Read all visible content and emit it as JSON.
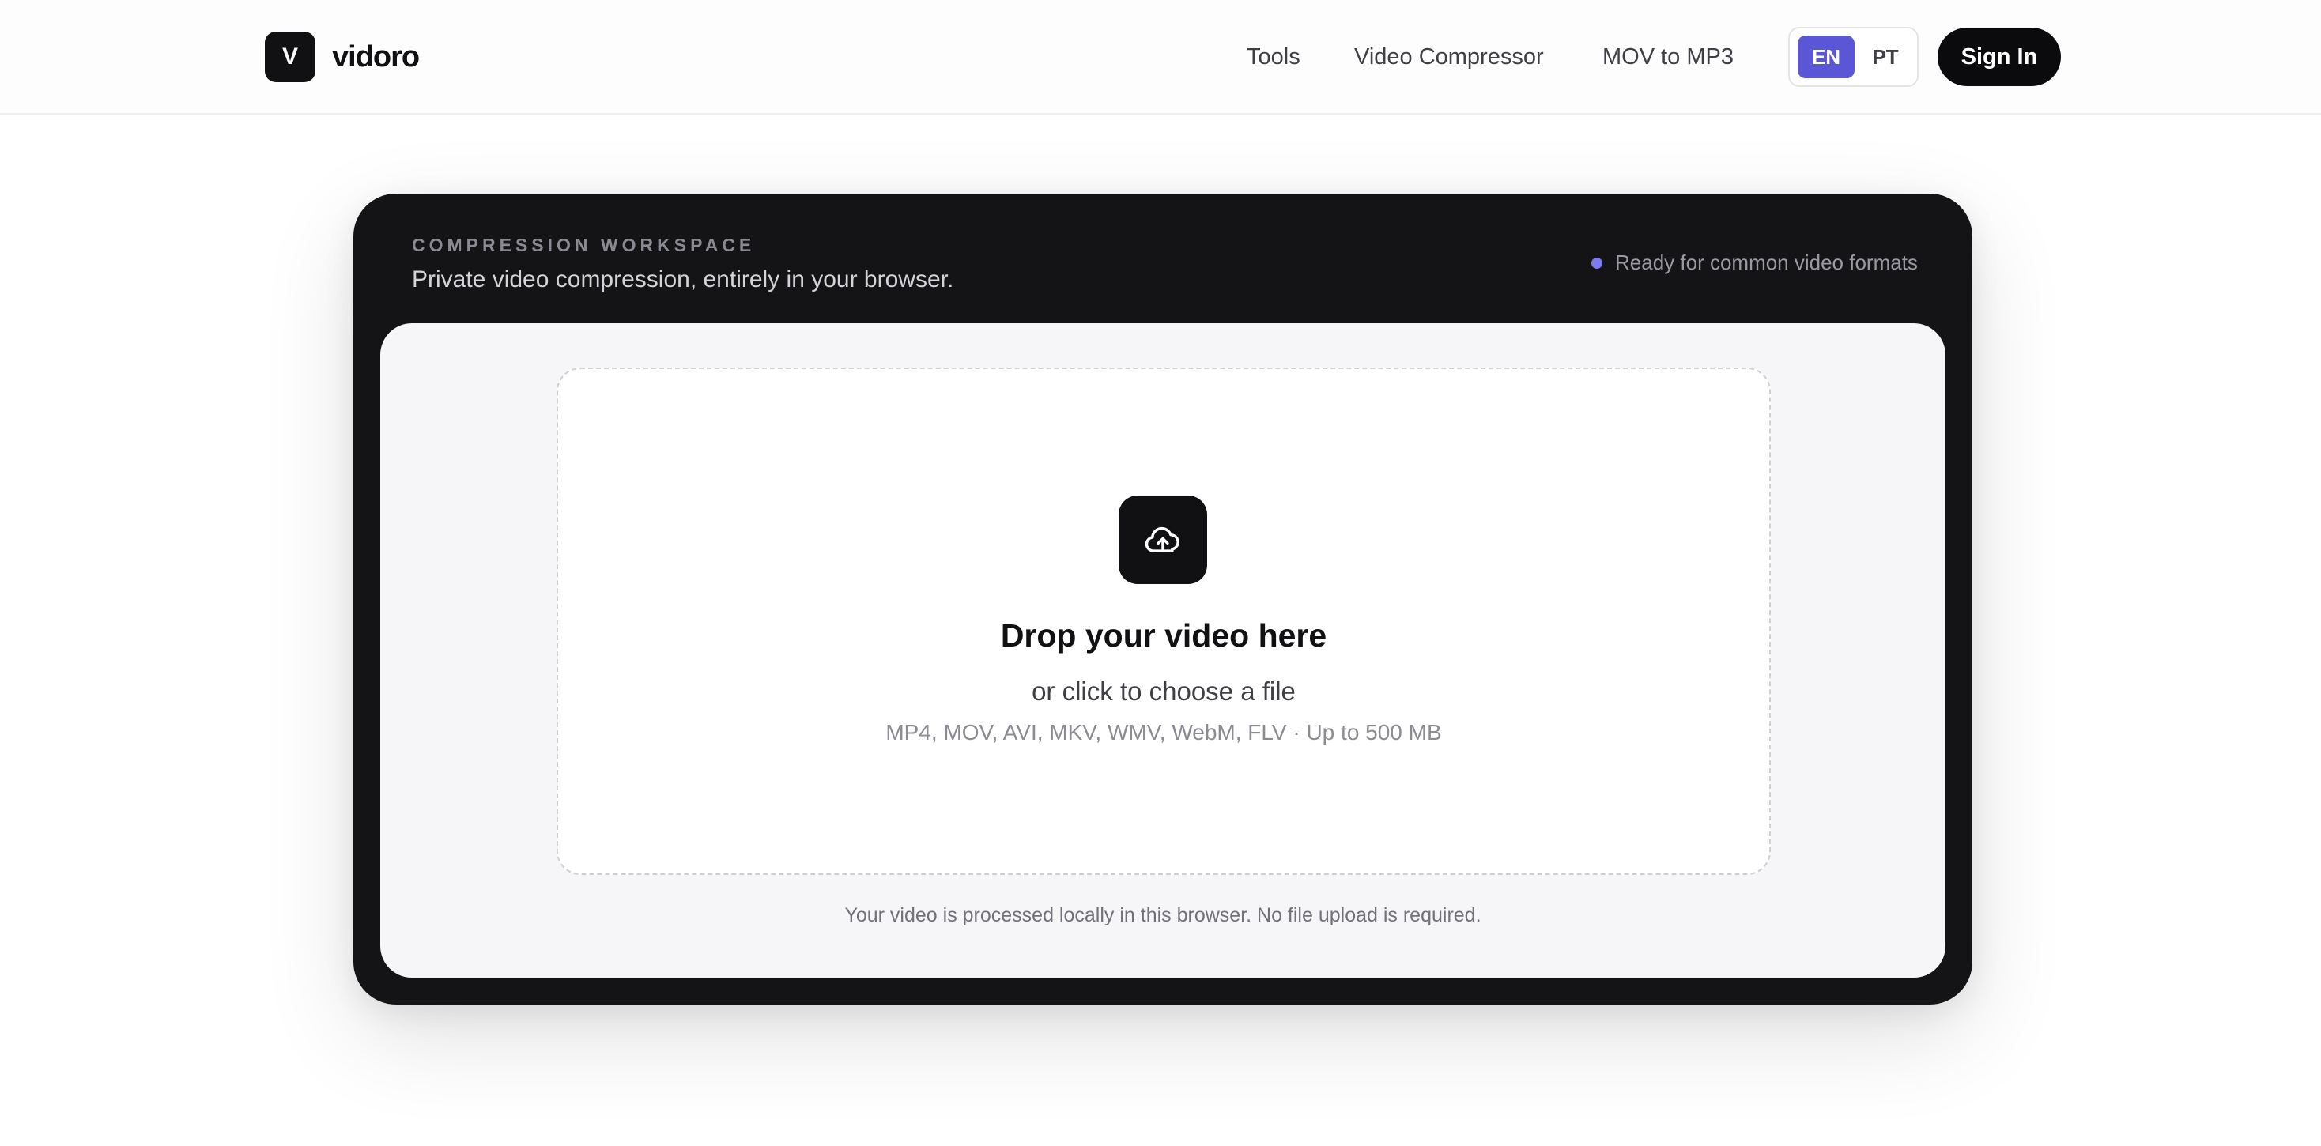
{
  "header": {
    "logo_letter": "V",
    "brand": "vidoro",
    "nav": {
      "tools": "Tools",
      "compressor": "Video Compressor",
      "mov_to_mp3": "MOV to MP3"
    },
    "language": {
      "en": "EN",
      "pt": "PT",
      "selected": "EN"
    },
    "sign_in": "Sign In"
  },
  "workspace": {
    "kicker": "COMPRESSION WORKSPACE",
    "subtitle": "Private video compression, entirely in your browser.",
    "status": "Ready for common video formats",
    "dropzone": {
      "icon": "cloud-upload-icon",
      "title": "Drop your video here",
      "subtitle": "or click to choose a file",
      "formats": "MP4, MOV, AVI, MKV, WMV, WebM, FLV · Up to 500 MB"
    },
    "privacy_note": "Your video is processed locally in this browser. No file upload is required."
  },
  "colors": {
    "accent": "#5b56d6",
    "status_dot": "#7c7cf2",
    "card_bg": "#141417",
    "button_dark": "#0b0b0d"
  }
}
